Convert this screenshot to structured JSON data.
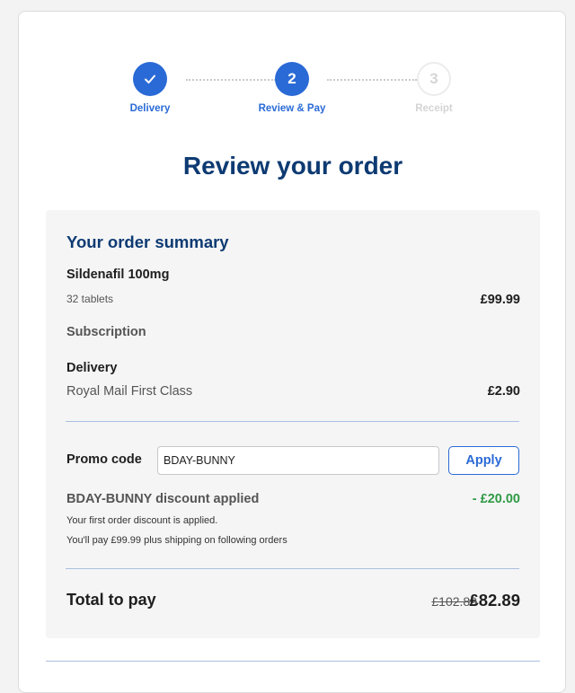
{
  "stepper": {
    "steps": [
      {
        "number": "✓",
        "label": "Delivery",
        "state": "done"
      },
      {
        "number": "2",
        "label": "Review & Pay",
        "state": "active"
      },
      {
        "number": "3",
        "label": "Receipt",
        "state": "pending"
      }
    ]
  },
  "page": {
    "title": "Review your order"
  },
  "summary": {
    "title": "Your order summary",
    "product": {
      "name": "Sildenafil 100mg",
      "quantity": "32 tablets",
      "price": "£99.99"
    },
    "subscription_label": "Subscription",
    "delivery": {
      "label": "Delivery",
      "method": "Royal Mail First Class",
      "price": "£2.90"
    },
    "promo": {
      "label": "Promo code",
      "value": "BDAY-BUNNY",
      "apply_label": "Apply"
    },
    "discount": {
      "title": "BDAY-BUNNY discount applied",
      "amount": "- £20.00",
      "note1": "Your first order discount is applied.",
      "note2": "You'll pay £99.99 plus shipping on following orders"
    },
    "total": {
      "label": "Total to pay",
      "original": "£102.89",
      "amount": "£82.89"
    }
  },
  "colors": {
    "accent": "#2a6ad6",
    "heading": "#0d3a72",
    "discount_green": "#2f9a45",
    "panel_bg": "#f5f5f6"
  }
}
